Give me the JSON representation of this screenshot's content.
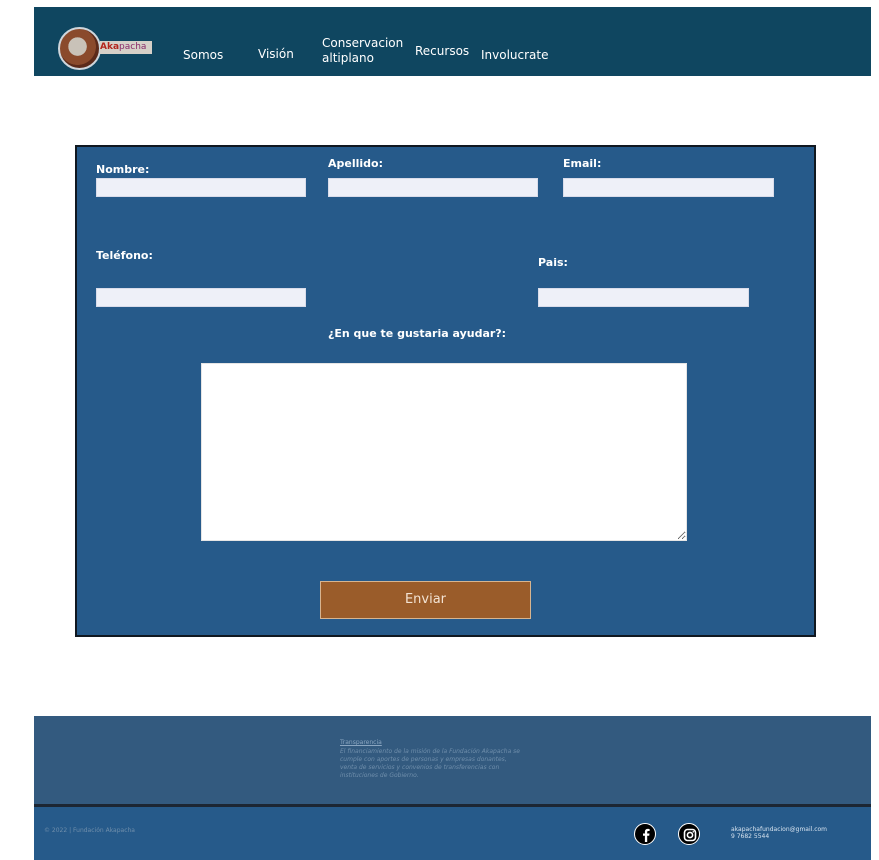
{
  "header": {
    "logo": {
      "brand_highlight": "ka",
      "brand_rest": "pacha",
      "brand_prefix": "A"
    },
    "nav": [
      {
        "label": "Somos"
      },
      {
        "label": "Visión"
      },
      {
        "label_line1": "Conservacion",
        "label_line2": "altiplano"
      },
      {
        "label": "Recursos"
      },
      {
        "label": "Involucrate"
      }
    ]
  },
  "form": {
    "nombre_label": "Nombre:",
    "apellido_label": "Apellido:",
    "email_label": "Email:",
    "telefono_label": "Teléfono:",
    "pais_label": "Pais:",
    "message_label": "¿En que te gustaria ayudar?:",
    "submit_label": "Enviar",
    "nombre_value": "",
    "apellido_value": "",
    "email_value": "",
    "telefono_value": "",
    "pais_value": "",
    "message_value": ""
  },
  "footer": {
    "about_title": "Transparencia",
    "about_text": "El financiamiento de la misión de la Fundación Akapacha se cumple con aportes de personas y empresas donantes, venta de servicios y convenios de transferencias con instituciones de Gobierno.",
    "copyright": "© 2022 | Fundación Akapacha",
    "email": "akapachafundacion@gmail.com",
    "phone": "9 7682 5544",
    "social": [
      "facebook-icon",
      "instagram-icon"
    ]
  }
}
